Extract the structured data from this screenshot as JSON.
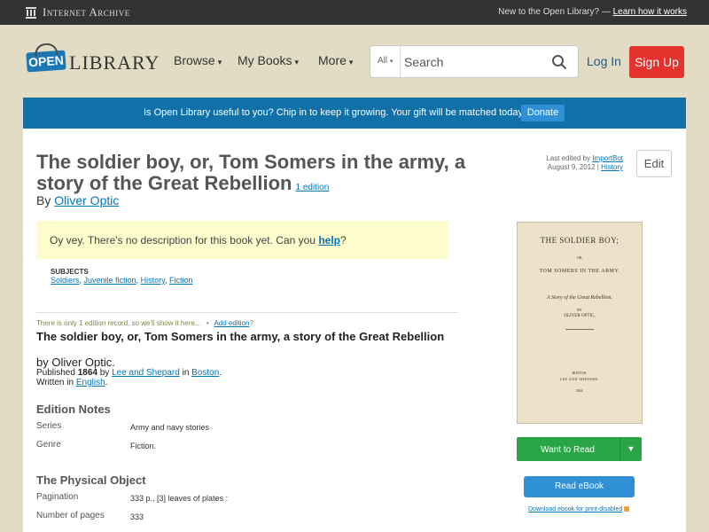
{
  "ia_bar": {
    "logo_text": "Internet Archive",
    "new_text": "New to the Open Library? —",
    "learn_link": "Learn how it works"
  },
  "header": {
    "logo_open": "OPEN",
    "logo_library": "LIBRARY",
    "nav": [
      "Browse",
      "My Books",
      "More"
    ],
    "search_scope": "All",
    "search_placeholder": "Search",
    "login": "Log In",
    "signup": "Sign Up"
  },
  "banner": {
    "message": "Is Open Library useful to you? Chip in to keep it growing. Your gift will be matched today!",
    "donate": "Donate"
  },
  "work": {
    "title": "The soldier boy, or, Tom Somers in the army, a story of the Great Rebellion",
    "edition_count": "1 edition",
    "by": "By",
    "author": "Oliver Optic",
    "last_edited_by": "Last edited by",
    "editor": "ImportBot",
    "edit_date": "August 9, 2012",
    "history": "History",
    "edit": "Edit",
    "no_desc_prefix": "Oy vey. There's no description for this book yet. Can you",
    "no_desc_help": "help",
    "no_desc_suffix": "?",
    "subjects_heading": "SUBJECTS",
    "subjects": [
      "Soldiers",
      "Juvenile fiction",
      "History",
      "Fiction"
    ]
  },
  "edition": {
    "only_one": "There is only 1 edition record, so we'll show it here...",
    "bullet": "•",
    "add_edition": "Add edition",
    "add_q": "?",
    "title": "The soldier boy, or, Tom Somers in the army, a story of the Great Rebellion",
    "by": "by Oliver Optic.",
    "published": "Published",
    "year": "1864",
    "pub_by": "by",
    "publisher": "Lee and Shepard",
    "pub_in": "in",
    "place": "Boston",
    "written_in": "Written in",
    "language": "English"
  },
  "edition_notes": {
    "heading": "Edition Notes",
    "rows": [
      {
        "key": "Series",
        "value": "Army and navy stories"
      },
      {
        "key": "Genre",
        "value": "Fiction."
      }
    ]
  },
  "physical": {
    "heading": "The Physical Object",
    "rows": [
      {
        "key": "Pagination",
        "value": "333 p., [3] leaves of plates :"
      },
      {
        "key": "Number of pages",
        "value": "333"
      }
    ]
  },
  "cover": {
    "line1": "THE SOLDIER BOY;",
    "line2": "OR,",
    "line3": "TOM SOMERS IN THE ARMY.",
    "line4": "A Story of the Great Rebellion.",
    "line5": "BY",
    "line6": "OLIVER OPTIC,",
    "line8": "BOSTON:",
    "line9": "LEE AND SHEPARD.",
    "line10": "1864."
  },
  "sidebar": {
    "want_to_read": "Want to Read",
    "read_ebook": "Read eBook",
    "download": "Download ebook for print-disabled"
  }
}
